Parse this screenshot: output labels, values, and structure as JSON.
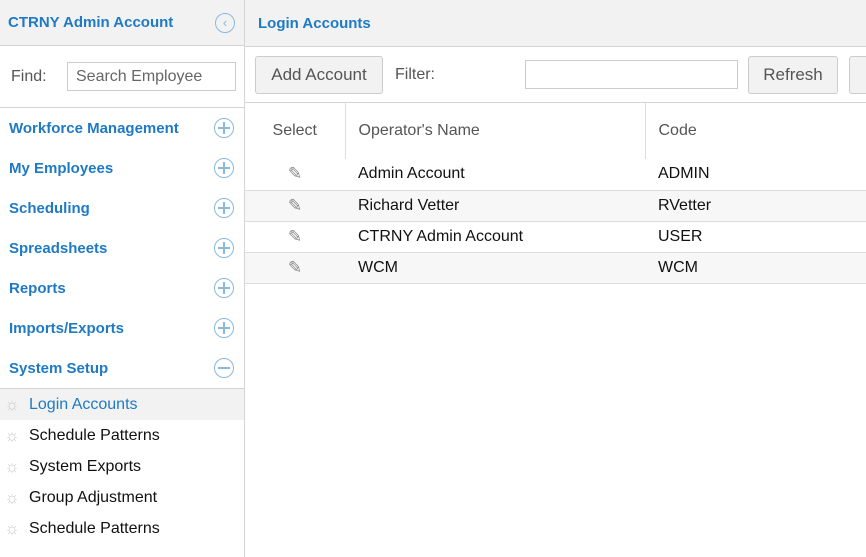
{
  "sidebar": {
    "title": "CTRNY Admin Account",
    "find_label": "Find:",
    "search_placeholder": "Search Employee",
    "sections": [
      {
        "label": "Workforce Management",
        "state": "collapsed"
      },
      {
        "label": "My Employees",
        "state": "collapsed"
      },
      {
        "label": "Scheduling",
        "state": "collapsed"
      },
      {
        "label": "Spreadsheets",
        "state": "collapsed"
      },
      {
        "label": "Reports",
        "state": "collapsed"
      },
      {
        "label": "Imports/Exports",
        "state": "collapsed"
      },
      {
        "label": "System Setup",
        "state": "expanded"
      }
    ],
    "sub_items": [
      {
        "label": "Login Accounts",
        "active": true
      },
      {
        "label": "Schedule Patterns"
      },
      {
        "label": "System Exports"
      },
      {
        "label": "Group Adjustment"
      },
      {
        "label": "Schedule Patterns"
      }
    ]
  },
  "main": {
    "title": "Login Accounts",
    "add_button": "Add Account",
    "filter_label": "Filter:",
    "filter_value": "",
    "refresh_button": "Refresh",
    "columns": [
      "Select",
      "Operator's Name",
      "Code"
    ],
    "rows": [
      {
        "name": "Admin Account",
        "code": "ADMIN"
      },
      {
        "name": "Richard Vetter",
        "code": "RVetter"
      },
      {
        "name": "CTRNY Admin Account",
        "code": "USER"
      },
      {
        "name": "WCM",
        "code": "WCM"
      }
    ]
  },
  "colors": {
    "accent": "#1f7ac4",
    "header_bg": "#f2f2f2"
  }
}
